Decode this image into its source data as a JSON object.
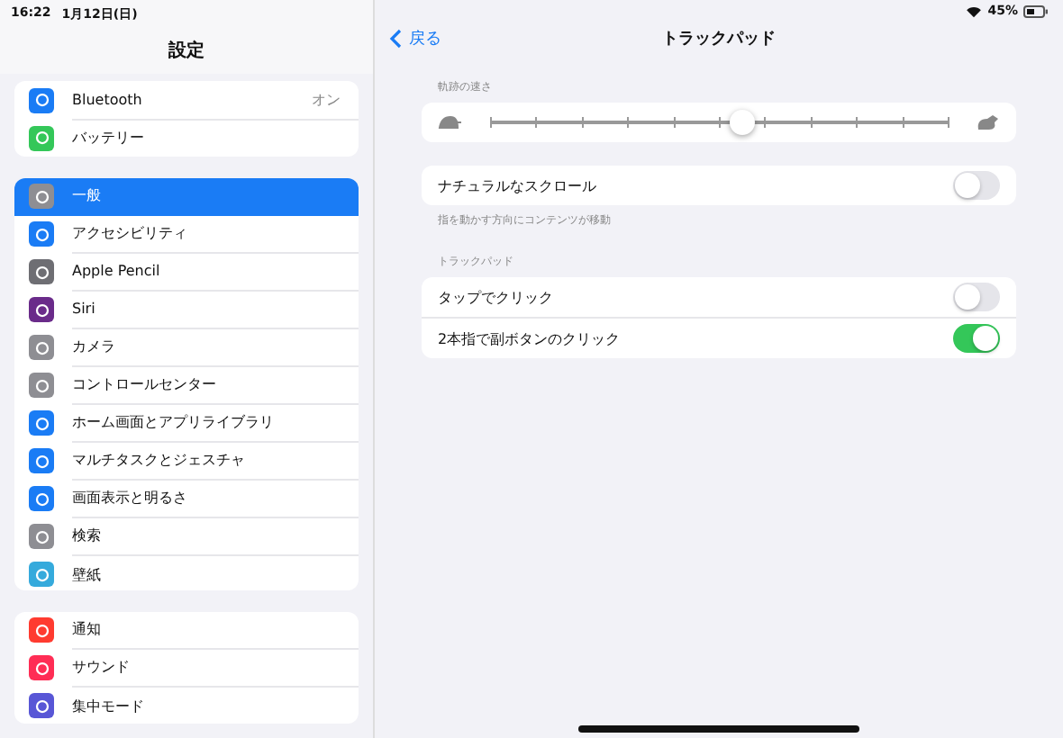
{
  "status_bar": {
    "time": "16:22",
    "date": "1月12日(日)",
    "battery": "45%"
  },
  "sidebar": {
    "title": "設定",
    "groups": [
      {
        "items": [
          {
            "label": "Bluetooth",
            "value": "オン",
            "color": "#1a7cf5",
            "selected": false
          },
          {
            "label": "バッテリー",
            "color": "#34c759",
            "selected": false
          }
        ]
      },
      {
        "items": [
          {
            "label": "一般",
            "color": "#8e8e93",
            "selected": true
          },
          {
            "label": "アクセシビリティ",
            "color": "#1a7cf5",
            "selected": false
          },
          {
            "label": "Apple Pencil",
            "color": "#6e6e73",
            "selected": false
          },
          {
            "label": "Siri",
            "color": "#6a2b8a",
            "selected": false
          },
          {
            "label": "カメラ",
            "color": "#8e8e93",
            "selected": false
          },
          {
            "label": "コントロールセンター",
            "color": "#8e8e93",
            "selected": false
          },
          {
            "label": "ホーム画面とアプリライブラリ",
            "color": "#1a7cf5",
            "selected": false
          },
          {
            "label": "マルチタスクとジェスチャ",
            "color": "#1a7cf5",
            "selected": false
          },
          {
            "label": "画面表示と明るさ",
            "color": "#1a7cf5",
            "selected": false
          },
          {
            "label": "検索",
            "color": "#8e8e93",
            "selected": false
          },
          {
            "label": "壁紙",
            "color": "#35aadc",
            "selected": false
          }
        ]
      },
      {
        "items": [
          {
            "label": "通知",
            "color": "#ff3b30",
            "selected": false
          },
          {
            "label": "サウンド",
            "color": "#ff2d55",
            "selected": false
          },
          {
            "label": "集中モード",
            "color": "#5856d6",
            "selected": false
          }
        ]
      }
    ]
  },
  "detail": {
    "back": "戻る",
    "title": "トラックパッド",
    "speed": {
      "header": "軌跡の速さ",
      "level": 0.55
    },
    "natural_scroll": {
      "label": "ナチュラルなスクロール",
      "on": false,
      "footer": "指を動かす方向にコンテンツが移動"
    },
    "trackpad": {
      "header": "トラックパッド",
      "rows": [
        {
          "label": "タップでクリック",
          "on": false
        },
        {
          "label": "2本指で副ボタンのクリック",
          "on": true
        }
      ]
    }
  }
}
